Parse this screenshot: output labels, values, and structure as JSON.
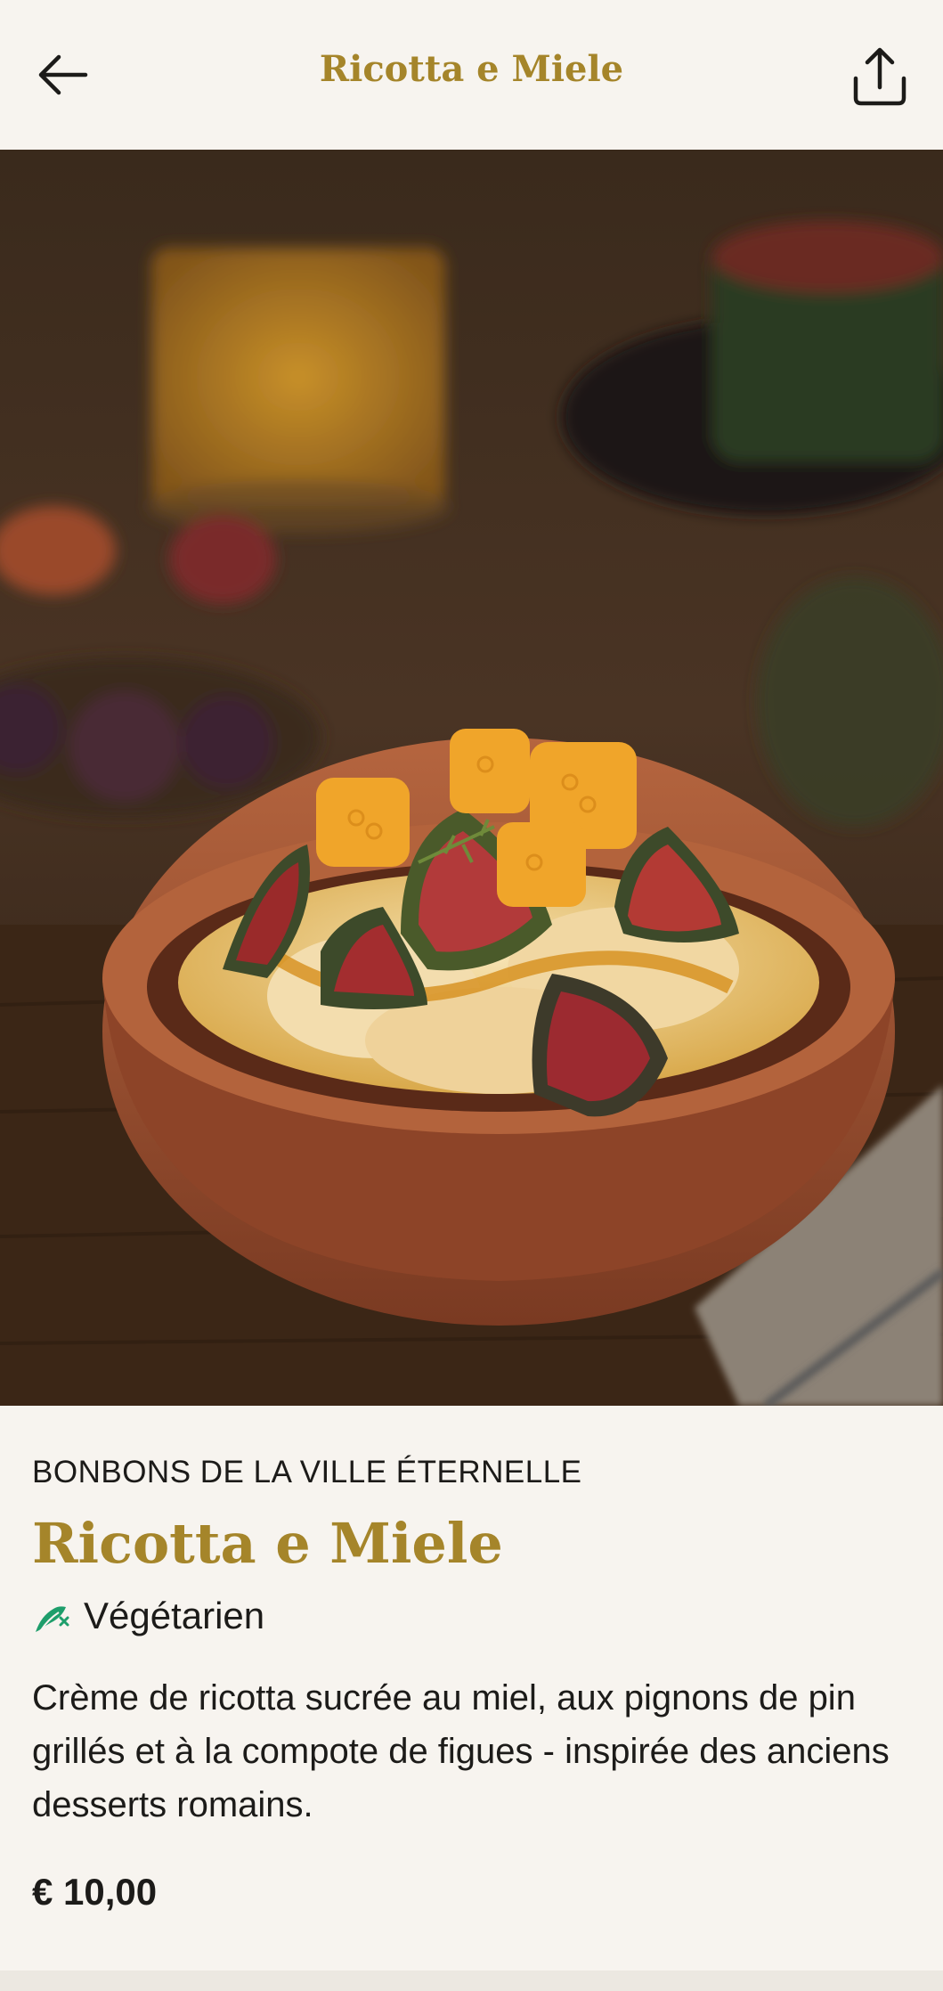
{
  "header": {
    "title": "Ricotta e Miele",
    "back_icon": "arrow-left-icon",
    "share_icon": "share-icon"
  },
  "hero": {
    "image": "ricotta-honey-figs-photo"
  },
  "dish": {
    "category": "BONBONS DE LA VILLE ÉTERNELLE",
    "name": "Ricotta e Miele",
    "diet_label": "Végétarien",
    "diet_icon": "vegetarian-icon",
    "description": "Crème de ricotta sucrée au miel, aux pignons de pin grillés et à la compote de figues - inspirée des anciens desserts romains.",
    "price": "€ 10,00"
  },
  "colors": {
    "accent": "#a5852a",
    "background": "#f7f4ef",
    "text": "#1c1b19",
    "veg_green": "#1e9e6b"
  }
}
